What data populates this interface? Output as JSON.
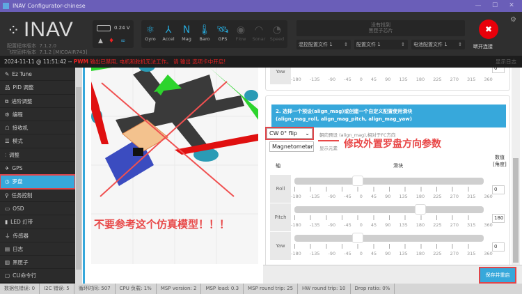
{
  "window": {
    "title": "INAV Configurator-chinese",
    "min": "—",
    "max": "☐",
    "close": "✕"
  },
  "header": {
    "logo": "INAV",
    "configurator_version_label": "配置程序版本",
    "configurator_version": "7.1.2.0",
    "firmware_version_label": "飞控固件版本",
    "firmware_version": "7.1.2 [MICOAIR743]",
    "battery_voltage": "0.24 V",
    "sensors": [
      {
        "label": "Gyro",
        "icon": "gyro-icon",
        "g": "⚛",
        "on": true
      },
      {
        "label": "Accel",
        "icon": "accel-icon",
        "g": "⅄",
        "on": true
      },
      {
        "label": "Mag",
        "icon": "mag-icon",
        "g": "N",
        "on": true
      },
      {
        "label": "Baro",
        "icon": "baro-icon",
        "g": "🌡",
        "on": true
      },
      {
        "label": "GPS",
        "icon": "gps-icon",
        "g": "🛰",
        "on": true
      },
      {
        "label": "Flow",
        "icon": "flow-icon",
        "g": "◉",
        "on": false
      },
      {
        "label": "Sonar",
        "icon": "sonar-icon",
        "g": "◠",
        "on": false
      },
      {
        "label": "Speed",
        "icon": "speed-icon",
        "g": "◔",
        "on": false
      }
    ],
    "firmware_notice": [
      "没有找到",
      "黑匣子芯片"
    ],
    "profiles": [
      "混控配置文件 1",
      "配置文件 1",
      "电池配置文件 1"
    ],
    "disconnect_label": "断开连接"
  },
  "log": {
    "timestamp": "2024-11-11 @ 11:51:42 --",
    "pwm": "PWM",
    "message": "输出已禁用, 电机和舵机无法工作。 请 输出 选项卡中开启!",
    "show_log": "显示日志"
  },
  "sidebar": {
    "items": [
      {
        "label": "Ez Tune",
        "icon": "wand-icon",
        "g": "✎"
      },
      {
        "label": "PID 调整",
        "icon": "pid-icon",
        "g": "品"
      },
      {
        "label": "进阶调整",
        "icon": "advanced-icon",
        "g": "⧉"
      },
      {
        "label": "编程",
        "icon": "programming-icon",
        "g": "⚙"
      },
      {
        "label": "接收机",
        "icon": "receiver-icon",
        "g": "☖"
      },
      {
        "label": "模式",
        "icon": "modes-icon",
        "g": "☰"
      },
      {
        "label": "调整",
        "icon": "adjust-icon",
        "g": "⫶"
      },
      {
        "label": "GPS",
        "icon": "gps-icon",
        "g": "✈"
      },
      {
        "label": "罗盘",
        "icon": "compass-icon",
        "g": "◷",
        "active": true
      },
      {
        "label": "任务控制",
        "icon": "mission-icon",
        "g": "⚲"
      },
      {
        "label": "OSD",
        "icon": "osd-icon",
        "g": "▭"
      },
      {
        "label": "LED 灯带",
        "icon": "led-icon",
        "g": "▮"
      },
      {
        "label": "传感器",
        "icon": "sensors-icon",
        "g": "⏚"
      },
      {
        "label": "日志",
        "icon": "log-icon",
        "g": "▤"
      },
      {
        "label": "黑匣子",
        "icon": "blackbox-icon",
        "g": "▥"
      },
      {
        "label": "CLI命令行",
        "icon": "cli-icon",
        "g": "▢"
      }
    ]
  },
  "viz": {
    "annotation": "不要参考这个仿真模型！！！"
  },
  "panel": {
    "ticks": [
      "-180",
      "-135",
      "-90",
      "-45",
      "0",
      "45",
      "90",
      "135",
      "180",
      "225",
      "270",
      "315",
      "360"
    ],
    "top_yaw": {
      "label": "Yaw",
      "value": "0"
    },
    "section_title": "2. 选择一个预设(align_mag)或创建一个自定义配置使用滑块",
    "section_sub": "(align_mag_roll, align_mag_pitch, align_mag_yaw)",
    "preset_select": "CW 0° flip",
    "preset_desc": "朝向预设 (align_mag),相对于FC方向",
    "element_select": "Magnetometer",
    "element_desc": "显示元素",
    "annotation": "修改外置罗盘方向参数",
    "col_axis": "轴",
    "col_slider": "滑块",
    "col_value": "数值 [角度]",
    "rows": [
      {
        "axis": "Roll",
        "value": 0
      },
      {
        "axis": "Pitch",
        "value": 180
      },
      {
        "axis": "Yaw",
        "value": 0
      }
    ],
    "range": [
      -180,
      360
    ]
  },
  "save_button": "保存并重启",
  "status": [
    "数据包错误: 0",
    "I2C 错误: 5",
    "循环时间: 507",
    "CPU 负载: 1%",
    "MSP version: 2",
    "MSP load: 0.3",
    "MSP round trip: 25",
    "HW round trip: 10",
    "Drop ratio: 0%"
  ]
}
